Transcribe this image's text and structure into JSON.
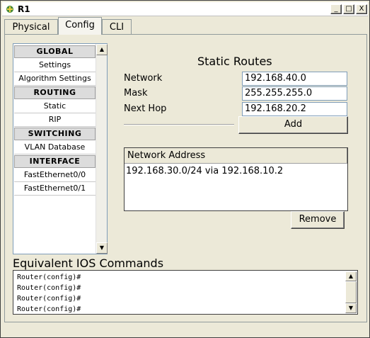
{
  "window": {
    "title": "R1",
    "minimize_glyph": "_",
    "maximize_glyph": "□",
    "close_glyph": "X"
  },
  "tabs": [
    {
      "label": "Physical"
    },
    {
      "label": "Config"
    },
    {
      "label": "CLI"
    }
  ],
  "nav": {
    "global_header": "GLOBAL",
    "settings": "Settings",
    "algorithm_settings": "Algorithm Settings",
    "routing_header": "ROUTING",
    "static": "Static",
    "rip": "RIP",
    "switching_header": "SWITCHING",
    "vlan_database": "VLAN Database",
    "interface_header": "INTERFACE",
    "fe00": "FastEthernet0/0",
    "fe01": "FastEthernet0/1"
  },
  "static_routes": {
    "title": "Static Routes",
    "network_label": "Network",
    "network_value": "192.168.40.0",
    "mask_label": "Mask",
    "mask_value": "255.255.255.0",
    "next_hop_label": "Next Hop",
    "next_hop_value": "192.168.20.2",
    "add_label": "Add",
    "table_header": "Network Address",
    "routes": [
      "192.168.30.0/24 via 192.168.10.2"
    ],
    "remove_label": "Remove"
  },
  "ios": {
    "title": "Equivalent IOS Commands",
    "lines": [
      "Router(config)#",
      "Router(config)#",
      "Router(config)#",
      "Router(config)#"
    ]
  },
  "icons": {
    "title": "router-icon",
    "scroll_up": "▲",
    "scroll_down": "▼"
  }
}
